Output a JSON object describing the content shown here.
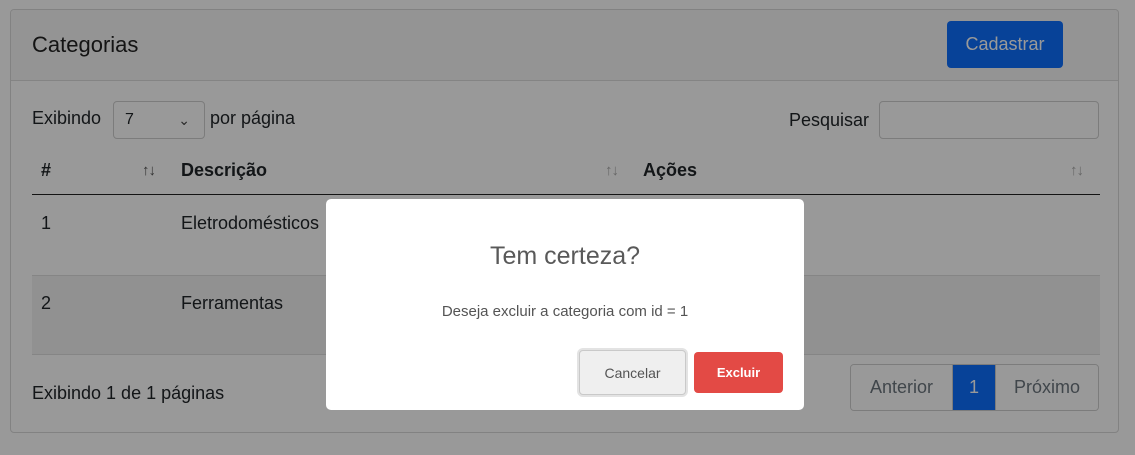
{
  "header": {
    "title": "Categorias",
    "create_button": "Cadastrar"
  },
  "controls": {
    "show_prefix": "Exibindo",
    "page_length": "7",
    "show_suffix": "por página",
    "search_label": "Pesquisar",
    "search_value": ""
  },
  "table": {
    "columns": [
      "#",
      "Descrição",
      "Ações"
    ],
    "rows": [
      {
        "id": "1",
        "description": "Eletrodomésticos"
      },
      {
        "id": "2",
        "description": "Ferramentas"
      }
    ]
  },
  "footer": {
    "info": "Exibindo 1 de 1 páginas",
    "prev": "Anterior",
    "current_page": "1",
    "next": "Próximo"
  },
  "modal": {
    "title": "Tem certeza?",
    "text": "Deseja excluir a categoria com id = 1",
    "cancel": "Cancelar",
    "confirm": "Excluir"
  },
  "colors": {
    "primary": "#0d6efd",
    "danger": "#e34a45",
    "overlay": "rgba(0,0,0,0.4)"
  },
  "icons": {
    "sort": "sort-arrows-icon",
    "select_chevron": "chevron-down-icon"
  }
}
